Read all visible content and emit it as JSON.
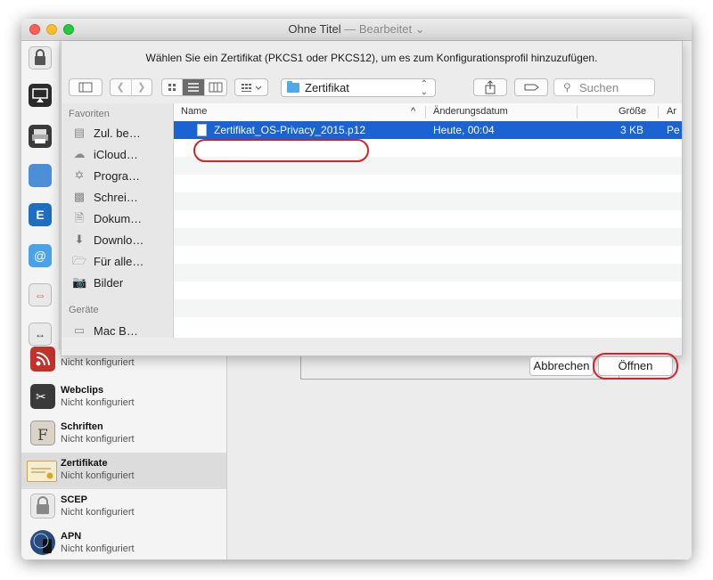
{
  "window": {
    "title": "Ohne Titel",
    "edited": "— Bearbeitet ⌄"
  },
  "dialog": {
    "message": "Wählen Sie ein Zertifikat (PKCS1 oder PKCS12), um es zum Konfigurationsprofil hinzuzufügen.",
    "location": "Zertifikat",
    "search_placeholder": "Suchen",
    "view_icons": [
      "icon-view-icon",
      "list-view-icon",
      "column-view-icon"
    ],
    "sidebar": {
      "favorites_label": "Favoriten",
      "favorites": [
        {
          "label": "Zul. be…",
          "icon": "recents-icon"
        },
        {
          "label": "iCloud…",
          "icon": "cloud-icon"
        },
        {
          "label": "Progra…",
          "icon": "applications-icon"
        },
        {
          "label": "Schrei…",
          "icon": "desktop-icon"
        },
        {
          "label": "Dokum…",
          "icon": "documents-icon"
        },
        {
          "label": "Downlo…",
          "icon": "downloads-icon"
        },
        {
          "label": "Für alle…",
          "icon": "folder-icon"
        },
        {
          "label": "Bilder",
          "icon": "pictures-icon"
        }
      ],
      "devices_label": "Geräte",
      "devices": [
        {
          "label": "Mac B…"
        }
      ]
    },
    "columns": {
      "name": "Name",
      "sort_indicator": "^",
      "date": "Änderungsdatum",
      "size": "Größe",
      "kind": "Ar"
    },
    "files": [
      {
        "name": "Zertifikat_OS-Privacy_2015.p12",
        "date": "Heute, 00:04",
        "size": "3 KB",
        "kind": "Pe",
        "selected": true
      }
    ],
    "cancel_label": "Abbrechen",
    "open_label": "Öffnen"
  },
  "payloads": [
    {
      "title": "",
      "subtitle": "Nicht konfiguriert",
      "icon": "rss-icon"
    },
    {
      "title": "Webclips",
      "subtitle": "Nicht konfiguriert",
      "icon": "webclip-icon"
    },
    {
      "title": "Schriften",
      "subtitle": "Nicht konfiguriert",
      "icon": "font-icon"
    },
    {
      "title": "Zertifikate",
      "subtitle": "Nicht konfiguriert",
      "icon": "certificate-icon",
      "selected": true
    },
    {
      "title": "SCEP",
      "subtitle": "Nicht konfiguriert",
      "icon": "scep-icon"
    },
    {
      "title": "APN",
      "subtitle": "Nicht konfiguriert",
      "icon": "apn-icon"
    }
  ],
  "colors": {
    "selection": "#1b62d2",
    "highlight_ring": "#d2232a",
    "close": "#fc5f57",
    "minimize": "#fdbc2e",
    "zoom": "#28c840"
  }
}
